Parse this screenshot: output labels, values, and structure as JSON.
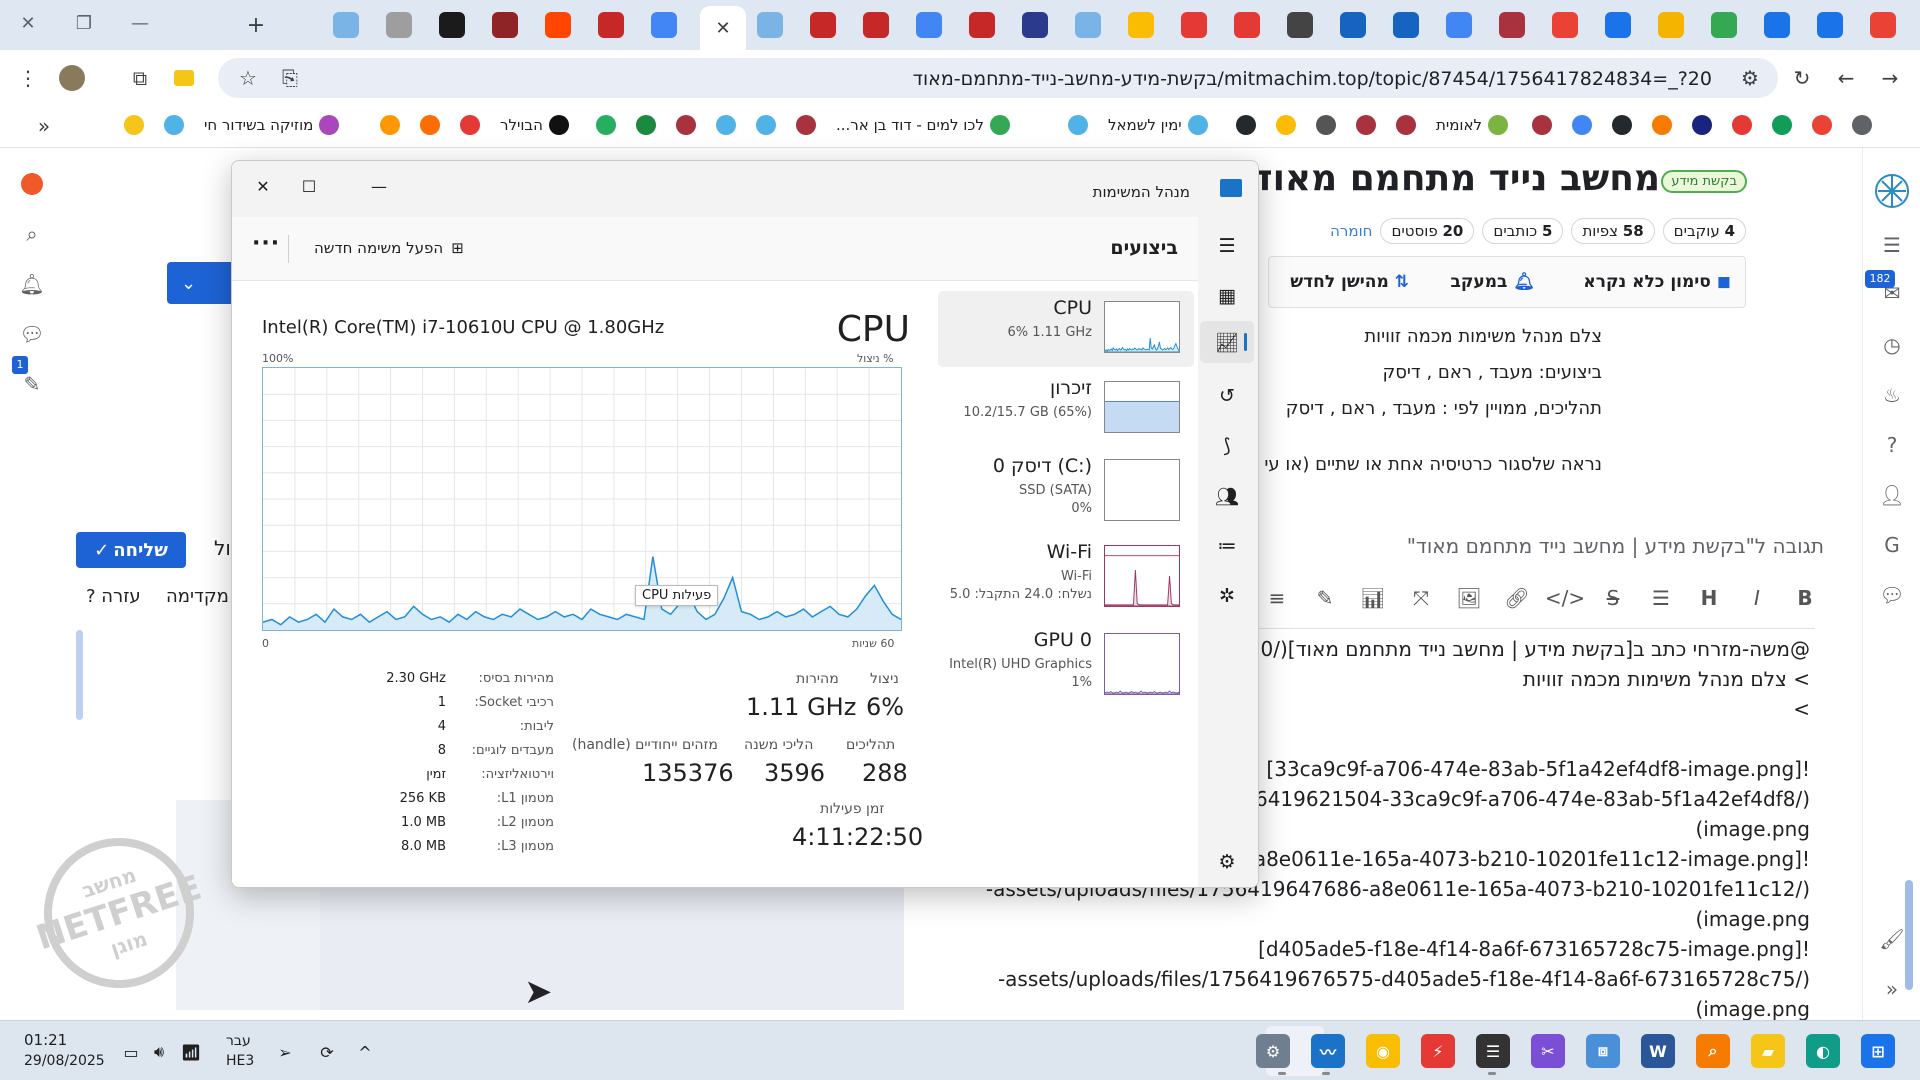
{
  "browser": {
    "url": "mitmachim.top/topic/87454/1756417824834=_?20/בקשת-מידע-מחשב-נייד-מתחמם-מאוד",
    "window_controls": [
      "✕",
      "❐",
      "—"
    ],
    "tab_icons": [
      "gmail-icon",
      "people-icon",
      "people-icon",
      "drive-icon",
      "ms-icon",
      "people-icon",
      "gmail-icon",
      "shield-icon",
      "google-icon",
      "puzzle-icon",
      "puzzle-icon",
      "ribbon-icon",
      "square-red-icon",
      "diamond-icon",
      "chrome-icon",
      "sphere-icon",
      "hummingbird-icon",
      "logo-icon",
      "google-icon",
      "logo-icon",
      "logo-icon",
      "sphere-icon",
      "google-icon",
      "google-icon",
      "logo-icon",
      "reddit-icon",
      "arabic-icon",
      "bird-icon",
      "globe-icon",
      "sphere-icon"
    ]
  },
  "bookmarks": [
    {
      "label": "",
      "icon": "grid-icon"
    },
    {
      "label": "",
      "icon": "gmail-icon"
    },
    {
      "label": "",
      "icon": "mail-green-icon"
    },
    {
      "label": "",
      "icon": "diamond-icon"
    },
    {
      "label": "",
      "icon": "bar-icon"
    },
    {
      "label": "",
      "icon": "fox-icon"
    },
    {
      "label": "",
      "icon": "github-icon"
    },
    {
      "label": "",
      "icon": "google-icon"
    },
    {
      "label": "",
      "icon": "shield-icon"
    },
    {
      "label": "לאומית",
      "icon": "leaf-icon"
    },
    {
      "label": "",
      "icon": "shield-icon"
    },
    {
      "label": "",
      "icon": "shield-icon"
    },
    {
      "label": "",
      "icon": "badge-icon"
    },
    {
      "label": "",
      "icon": "pinwheel-icon"
    },
    {
      "label": "",
      "icon": "github-icon"
    },
    {
      "label": "ימין לשמאל",
      "icon": "sphere-icon"
    },
    {
      "label": "",
      "icon": "sphere-icon"
    },
    {
      "label": "לכו למים - דוד בן אר...",
      "icon": "drive-icon"
    },
    {
      "label": "",
      "icon": "shield-icon"
    },
    {
      "label": "",
      "icon": "sphere-icon"
    },
    {
      "label": "",
      "icon": "sphere-icon"
    },
    {
      "label": "",
      "icon": "shield-icon"
    },
    {
      "label": "",
      "icon": "x-icon"
    },
    {
      "label": "",
      "icon": "person-icon"
    },
    {
      "label": "הבוילר",
      "icon": "info-icon"
    },
    {
      "label": "",
      "icon": "square-red-icon"
    },
    {
      "label": "",
      "icon": "orange-icon"
    },
    {
      "label": "",
      "icon": "orange2-icon"
    },
    {
      "label": "מוזיקה בשידור חי",
      "icon": "music-icon"
    },
    {
      "label": "",
      "icon": "sphere-icon"
    },
    {
      "label": "",
      "icon": "b-icon"
    }
  ],
  "forum": {
    "topic_title": "מחשב נייד מתחמם מאוד",
    "tag": "בקשת מידע",
    "stats": [
      {
        "value": "20",
        "label": "פוסטים"
      },
      {
        "value": "5",
        "label": "כותבים"
      },
      {
        "value": "58",
        "label": "צפיות"
      },
      {
        "value": "4",
        "label": "עוקבים"
      }
    ],
    "category_link": "חומרה",
    "actions": {
      "mark_read": "סימון כלא נקרא",
      "watching": "במעקב",
      "sort": "מהישן לחדש"
    },
    "post_lines": [
      "צלם מנהל משימות מכמה זוויות",
      "ביצועים: מעבד , ראם , דיסק",
      "תהליכים, ממויין לפי : מעבד , ראם , דיסק",
      "נראה שלסגור כרטיסיה אחת או שתיים (או עי"
    ],
    "reply_title": "תגובה ל\"בקשת מידע | מחשב נייד מתחמם מאוד\"",
    "composer_lines": [
      "@משה-מזרחי כתב ב[בקשת מידע | מחשב נייד מתחמם מאוד](/30",
      "> צלם מנהל משימות מכמה זוויות",
      ">",
      "",
      "![33ca9c9f-a706-474e-83ab-5f1a42ef4df8-image.png]",
      "(/assets/uploads/files/1756419621504-33ca9c9f-a706-474e-83ab-5f1a42ef4df8-",
      "image.png)",
      "![a8e0611e-165a-4073-b210-10201fe11c12-image.png]",
      "(/assets/uploads/files/1756419647686-a8e0611e-165a-4073-b210-10201fe11c12-",
      "image.png)",
      "![d405ade5-f18e-4f14-8a6f-673165728c75-image.png]",
      "(/assets/uploads/files/1756419676575-d405ade5-f18e-4f14-8a6f-673165728c75-",
      "image.png)"
    ],
    "send_label": "שליחה",
    "partial_label": "ול",
    "preview_label": "מקדימה",
    "help_label": "עזרה ?",
    "notification_badge": "1",
    "inbox_badge": "182",
    "watermark_top": "מחשב",
    "watermark_mid": "NETFREE",
    "watermark_bottom": "מוגן"
  },
  "task_manager": {
    "window_title": "מנהל המשימות",
    "section_title": "ביצועים",
    "new_task": "הפעל משימה חדשה",
    "more": "···",
    "cpu_label": "CPU",
    "cpu_model": "Intel(R) Core(TM) i7-10610U CPU @ 1.80GHz",
    "axis": {
      "top_right": "% ניצול",
      "top_left": "100%",
      "bottom_right": "60 שניות",
      "bottom_left": "0"
    },
    "tooltip": "פעילות CPU",
    "perf_items": [
      {
        "name": "CPU",
        "sub1": "6%  1.11 GHz",
        "sub2": "",
        "sub3": ""
      },
      {
        "name": "זיכרון",
        "sub1": "10.2/15.7 GB (65%)",
        "sub2": "",
        "sub3": ""
      },
      {
        "name": "דיסק 0 (C:)",
        "sub1": "SSD (SATA)",
        "sub2": "0%",
        "sub3": ""
      },
      {
        "name": "Wi-Fi",
        "sub1": "Wi-Fi",
        "sub2": "נשלח: 24.0 התקבל: 5.0",
        "sub3": ""
      },
      {
        "name": "GPU 0",
        "sub1": "Intel(R) UHD Graphics",
        "sub2": "1%",
        "sub3": ""
      }
    ],
    "metrics": {
      "util_label": "ניצול",
      "util_value": "6%",
      "speed_label": "מהירות",
      "speed_value": "1.11 GHz",
      "proc_label": "תהליכים",
      "proc_value": "288",
      "threads_label": "הליכי משנה",
      "threads_value": "3596",
      "handles_label": "מזהים ייחודיים (handle)",
      "handles_value": "135376",
      "uptime_label": "זמן פעילות",
      "uptime_value": "4:11:22:50"
    },
    "specs": [
      {
        "label": "מהירות בסיס:",
        "value": "2.30 GHz"
      },
      {
        "label": "רכיבי Socket:",
        "value": "1"
      },
      {
        "label": "ליבות:",
        "value": "4"
      },
      {
        "label": "מעבדים לוגיים:",
        "value": "8"
      },
      {
        "label": "וירטואליזציה:",
        "value": "זמין"
      },
      {
        "label": "מטמון L1:",
        "value": "256 KB"
      },
      {
        "label": "מטמון L2:",
        "value": "1.0 MB"
      },
      {
        "label": "מטמון L3:",
        "value": "8.0 MB"
      }
    ],
    "cpu_history": [
      3,
      4,
      2,
      5,
      3,
      4,
      6,
      3,
      8,
      5,
      4,
      6,
      3,
      5,
      7,
      4,
      5,
      9,
      6,
      4,
      5,
      3,
      6,
      4,
      7,
      5,
      4,
      6,
      5,
      8,
      6,
      4,
      5,
      7,
      5,
      6,
      4,
      8,
      6,
      5,
      4,
      6,
      5,
      4,
      28,
      8,
      6,
      10,
      14,
      7,
      4,
      6,
      12,
      20,
      7,
      6,
      4,
      5,
      7,
      5,
      6,
      8,
      5,
      7,
      9,
      6,
      5,
      8,
      13,
      17,
      11,
      6,
      4
    ]
  },
  "taskbar": {
    "time": "01:21",
    "date": "29/08/2025",
    "lang_top": "עבר",
    "lang_bottom": "HE3"
  }
}
